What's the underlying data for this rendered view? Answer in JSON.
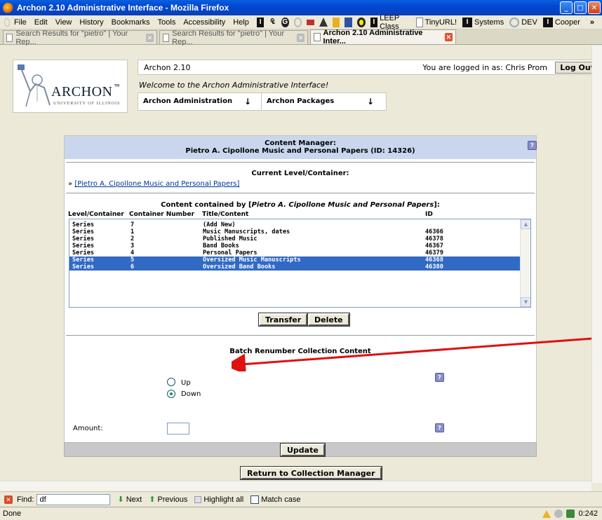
{
  "window": {
    "title": "Archon 2.10 Administrative Interface - Mozilla Firefox",
    "minimize": "_",
    "maximize": "□",
    "close": "✕"
  },
  "menu": [
    "File",
    "Edit",
    "View",
    "History",
    "Bookmarks",
    "Tools",
    "Accessibility",
    "Help"
  ],
  "bookmarks": [
    "LEEP Class",
    "TinyURL!",
    "Systems",
    "DEV",
    "Cooper"
  ],
  "more": "»",
  "tabs": [
    {
      "label": "Search Results for \"pietro\" | Your Rep...",
      "active": false
    },
    {
      "label": "Search Results for \"pietro\" | Your Rep...",
      "active": false
    },
    {
      "label": "Archon 2.10 Administrative Inter...",
      "active": true
    }
  ],
  "header": {
    "logo_text": "ARCHON",
    "logo_tm": "TM",
    "logo_sub": "UNIVERSITY OF ILLINOIS",
    "version": "Archon 2.10",
    "logged_in": "You are logged in as: Chris Prom",
    "logout": "Log Out",
    "welcome": "Welcome to the Archon Administrative Interface!",
    "nav1": "Archon Administration",
    "nav2": "Archon Packages",
    "arrow": "↓"
  },
  "panel": {
    "title1": "Content Manager:",
    "title2": "Pietro A. Cipollone Music and Personal Papers (ID: 14326)",
    "current_level": "Current Level/Container:",
    "crumb_prefix": "»",
    "crumb_link": "[Pietro A. Cipollone Music and Personal Papers]",
    "contained_prefix": "Content contained by [",
    "contained_name": "Pietro A. Cipollone Music and Personal Papers",
    "contained_suffix": "]:",
    "columns": {
      "level": "Level/Container",
      "number": "Container Number",
      "title": "Title/Content",
      "id": "ID"
    },
    "rows": [
      {
        "level": "Series",
        "number": "7",
        "title": "(Add New)",
        "id": "",
        "selected": false
      },
      {
        "level": "Series",
        "number": "1",
        "title": "Music Manuscripts, dates",
        "id": "46366",
        "selected": false
      },
      {
        "level": "Series",
        "number": "2",
        "title": "Published Music",
        "id": "46378",
        "selected": false
      },
      {
        "level": "Series",
        "number": "3",
        "title": "Band Books",
        "id": "46367",
        "selected": false
      },
      {
        "level": "Series",
        "number": "4",
        "title": "Personal Papers",
        "id": "46379",
        "selected": false
      },
      {
        "level": "Series",
        "number": "5",
        "title": "Oversized Music Manuscripts",
        "id": "46368",
        "selected": true
      },
      {
        "level": "Series",
        "number": "6",
        "title": "Oversized Band Books",
        "id": "46380",
        "selected": true
      }
    ],
    "transfer": "Transfer",
    "delete": "Delete",
    "batch_title": "Batch Renumber Collection Content",
    "up": "Up",
    "down": "Down",
    "direction_selected": "Down",
    "amount_label": "Amount:",
    "amount_value": "",
    "update": "Update",
    "return": "Return to Collection Manager",
    "help_glyph": "?"
  },
  "findbar": {
    "label": "Find:",
    "value": "df",
    "next": "Next",
    "previous": "Previous",
    "highlight": "Highlight all",
    "match_case": "Match case"
  },
  "status": {
    "text": "Done",
    "time": "0:242"
  },
  "colors": {
    "selection": "#316ac5",
    "panel_header": "#c9d6ee",
    "arrow": "#dd1111"
  }
}
